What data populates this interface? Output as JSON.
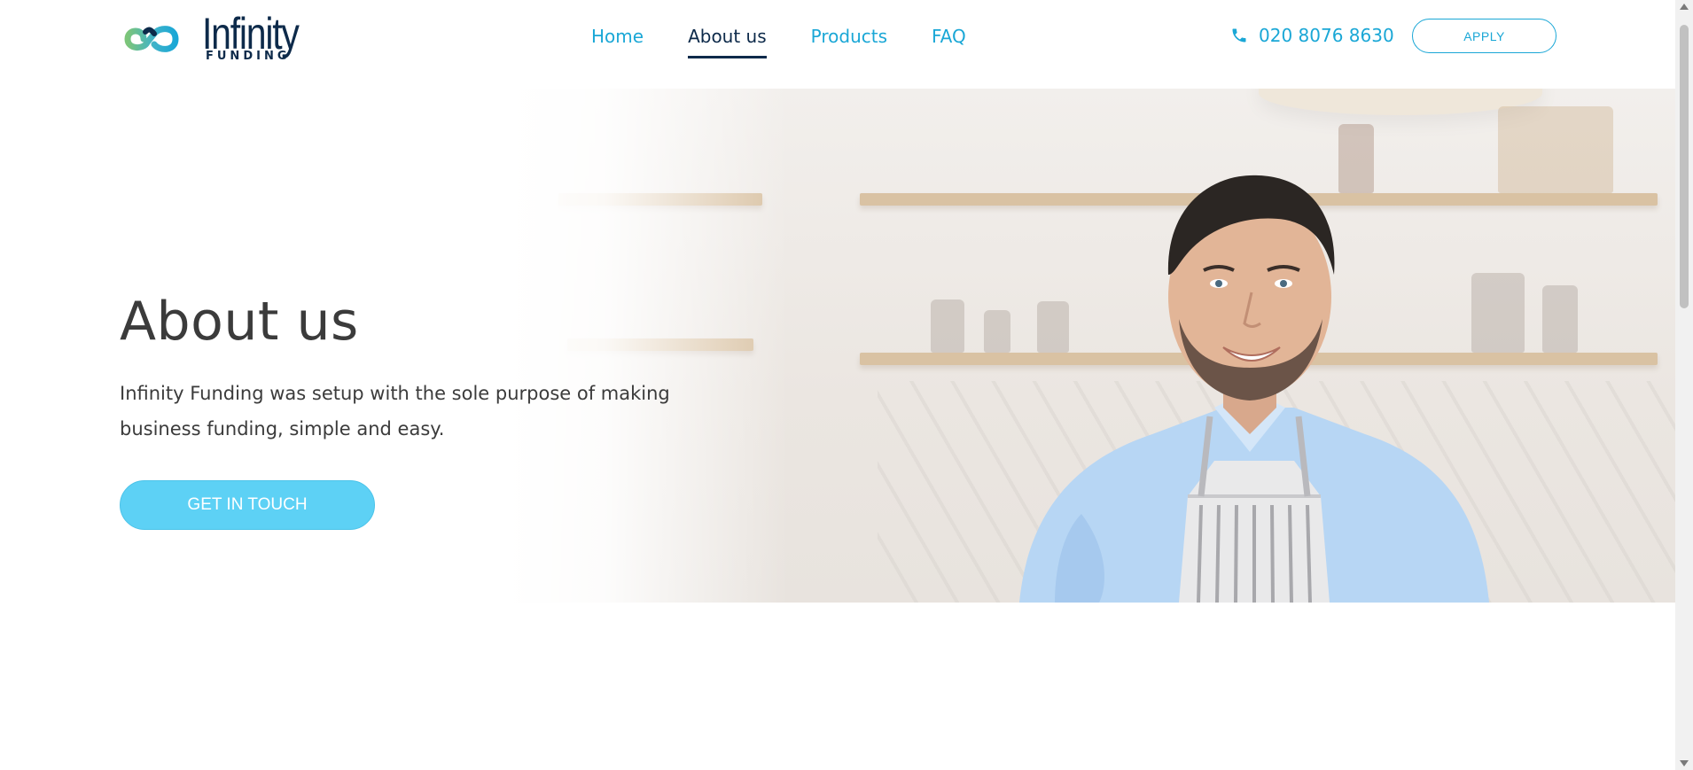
{
  "brand": {
    "name": "Infinity",
    "tagline": "FUNDING",
    "colors": {
      "navy": "#0d2a4a",
      "accent": "#1aa7d6",
      "button": "#5dd1f5",
      "logo_green": "#6cc08a"
    }
  },
  "nav": {
    "items": [
      {
        "label": "Home",
        "active": false
      },
      {
        "label": "About us",
        "active": true
      },
      {
        "label": "Products",
        "active": false
      },
      {
        "label": "FAQ",
        "active": false
      }
    ]
  },
  "contact": {
    "phone_icon": "phone-icon",
    "phone": "020 8076 8630",
    "apply_label": "APPLY"
  },
  "hero": {
    "title": "About us",
    "subtitle": "Infinity Funding was setup with the sole purpose of making business funding, simple and easy.",
    "cta_label": "GET IN TOUCH",
    "image": "smiling-man-in-apron-photo"
  }
}
